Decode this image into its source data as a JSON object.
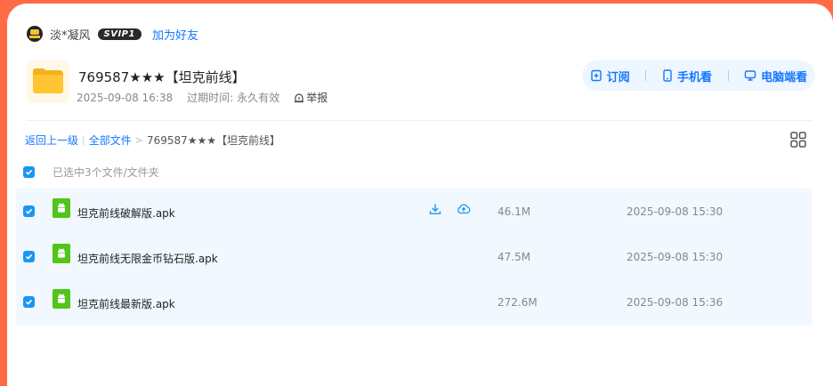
{
  "user": {
    "name": "淡*凝风",
    "vip_badge": "SVIP1",
    "add_friend": "加为好友"
  },
  "share": {
    "title": "769587★★★【坦克前线】",
    "created": "2025-09-08 16:38",
    "expire_label": "过期时间:",
    "expire_value": "永久有效",
    "report": "举报"
  },
  "actions": {
    "subscribe": "订阅",
    "phone": "手机看",
    "pc": "电脑端看"
  },
  "breadcrumb": {
    "back": "返回上一级",
    "all_files": "全部文件",
    "sep": ">",
    "current": "769587★★★【坦克前线】"
  },
  "selection": {
    "text": "已选中3个文件/文件夹"
  },
  "files": [
    {
      "name": "坦克前线破解版.apk",
      "size": "46.1M",
      "date": "2025-09-08 15:30"
    },
    {
      "name": "坦克前线无限金币钻石版.apk",
      "size": "47.5M",
      "date": "2025-09-08 15:30"
    },
    {
      "name": "坦克前线最新版.apk",
      "size": "272.6M",
      "date": "2025-09-08 15:36"
    }
  ],
  "colors": {
    "accent": "#1677ff",
    "checkbox": "#1c95f2",
    "row_bg": "#f1f8ff",
    "outer_bg": "#ff6b45",
    "apk_green": "#52c41a"
  },
  "icons": [
    "avatar",
    "folder-icon",
    "report-icon",
    "subscribe-icon",
    "phone-icon",
    "monitor-icon",
    "grid-view-icon",
    "check-icon",
    "android-icon",
    "download-icon",
    "cloud-save-icon"
  ]
}
